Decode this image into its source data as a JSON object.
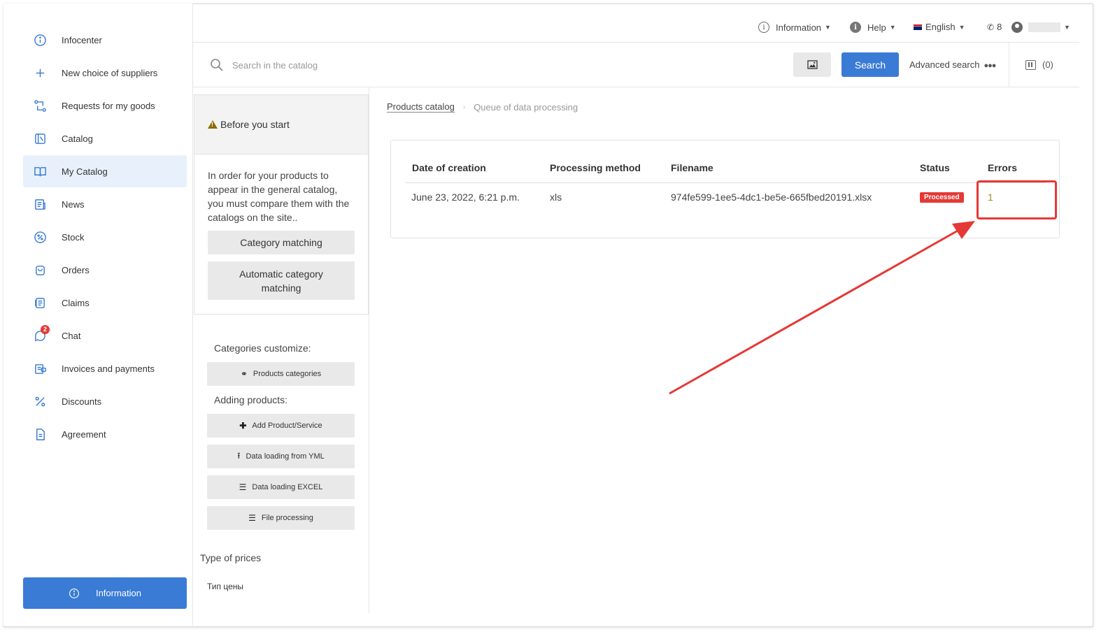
{
  "sidebar": {
    "items": [
      {
        "label": "Infocenter",
        "icon": "info-circle-icon"
      },
      {
        "label": "New choice of suppliers",
        "icon": "plus-icon"
      },
      {
        "label": "Requests for my goods",
        "icon": "swap-icon"
      },
      {
        "label": "Catalog",
        "icon": "catalog-icon"
      },
      {
        "label": "My Catalog",
        "icon": "open-book-icon",
        "active": true
      },
      {
        "label": "News",
        "icon": "news-icon"
      },
      {
        "label": "Stock",
        "icon": "percent-circle-icon"
      },
      {
        "label": "Orders",
        "icon": "bag-icon"
      },
      {
        "label": "Claims",
        "icon": "claims-icon"
      },
      {
        "label": "Chat",
        "icon": "chat-icon",
        "badge": "2"
      },
      {
        "label": "Invoices and payments",
        "icon": "invoice-icon"
      },
      {
        "label": "Discounts",
        "icon": "percent-icon"
      },
      {
        "label": "Agreement",
        "icon": "document-icon"
      }
    ],
    "info_button": "Information"
  },
  "topbar": {
    "information": "Information",
    "help": "Help",
    "language": "English",
    "phone_count": "8"
  },
  "search": {
    "placeholder": "Search in the catalog",
    "button": "Search",
    "advanced": "Advanced search",
    "compare_count": "(0)"
  },
  "midpanel": {
    "before_title": "Before you start",
    "before_text": "In order for your products to appear in the general catalog, you must compare them with the catalogs on the site..",
    "category_matching": "Category matching",
    "auto_matching": "Automatic category matching",
    "categories_customize": "Categories customize:",
    "products_categories": "Products categories",
    "adding_products": "Adding products:",
    "add_product": "Add Product/Service",
    "data_yml": "Data loading from YML",
    "data_excel": "Data loading EXCEL",
    "file_processing": "File processing",
    "type_of_prices": "Type of prices",
    "price_type_ru": "Тип цены"
  },
  "breadcrumb": {
    "link": "Products catalog",
    "current": "Queue of data processing"
  },
  "table": {
    "headers": [
      "Date of creation",
      "Processing method",
      "Filename",
      "Status",
      "Errors"
    ],
    "rows": [
      {
        "date": "June 23, 2022, 6:21 p.m.",
        "method": "xls",
        "filename": "974fe599-1ee5-4dc1-be5e-665fbed20191.xlsx",
        "status": "Processed",
        "errors": "1"
      }
    ]
  },
  "colors": {
    "accent": "#3a7bd5",
    "status_processed": "#e53935",
    "annotation": "#e53935"
  }
}
